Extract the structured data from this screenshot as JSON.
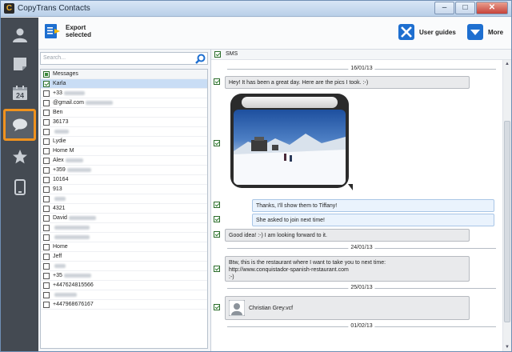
{
  "window": {
    "title": "CopyTrans Contacts"
  },
  "toolbar": {
    "export_label_line1": "Export",
    "export_label_line2": "selected",
    "user_guides_label": "User guides",
    "more_label": "More"
  },
  "nav": {
    "items": [
      "contacts-icon",
      "notes-icon",
      "calendar-icon",
      "messages-icon",
      "favorites-icon",
      "phone-icon"
    ],
    "calendar_day": "24",
    "active": "messages"
  },
  "search": {
    "placeholder": "Search..."
  },
  "list": {
    "header": "Messages",
    "rows": [
      {
        "text": "Karla",
        "checked": true,
        "selected": true
      },
      {
        "text": "+33",
        "checked": false
      },
      {
        "text": "@gmail.com",
        "checked": false
      },
      {
        "text": "Ben",
        "checked": false
      },
      {
        "text": "36173",
        "checked": false
      },
      {
        "text": "",
        "checked": false
      },
      {
        "text": "Lydie",
        "checked": false
      },
      {
        "text": "Home M",
        "checked": false
      },
      {
        "text": "Alex",
        "checked": false
      },
      {
        "text": "+359",
        "checked": false
      },
      {
        "text": "10164",
        "checked": false
      },
      {
        "text": "913",
        "checked": false
      },
      {
        "text": "",
        "checked": false
      },
      {
        "text": "4321",
        "checked": false
      },
      {
        "text": "David",
        "checked": false
      },
      {
        "text": "",
        "checked": false
      },
      {
        "text": "",
        "checked": false
      },
      {
        "text": "Home",
        "checked": false
      },
      {
        "text": "Jeff",
        "checked": false
      },
      {
        "text": "",
        "checked": false
      },
      {
        "text": "+35",
        "checked": false
      },
      {
        "text": "+447624815566",
        "checked": false
      },
      {
        "text": "",
        "checked": false
      },
      {
        "text": "+447968676167",
        "checked": false
      }
    ]
  },
  "conversation": {
    "header": "SMS",
    "dates": [
      "16/01/13",
      "24/01/13",
      "25/01/13",
      "01/02/13"
    ],
    "messages": {
      "m1": "Hey! It has been a great day. Here are the pics I took. :-)",
      "m2": "Thanks, I'll show them to Tiffany!",
      "m3": "She asked to join next time!",
      "m4": "Good idea! :-) I am looking forward to it.",
      "m5_line1": "Btw, this is the restaurant where I want to take you to next time:",
      "m5_line2": "http://www.conquistador-spanish-restaurant.com",
      "m5_line3": ":-)",
      "m6": "Christian Grey.vcf"
    }
  },
  "colors": {
    "nav_bg": "#444a52",
    "nav_active_border": "#f0921e",
    "accent_blue": "#1e6fd0"
  }
}
